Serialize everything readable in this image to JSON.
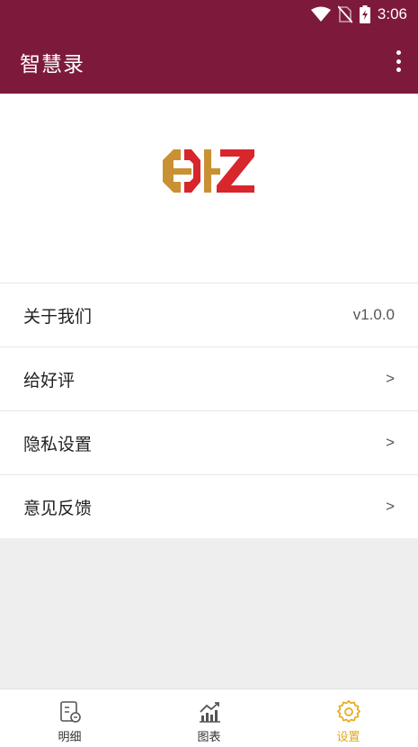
{
  "status_bar": {
    "time": "3:06",
    "icons": [
      "wifi-icon",
      "no-sim-icon",
      "battery-charging-icon"
    ]
  },
  "app_bar": {
    "title": "智慧录",
    "menu_icon": "more-vert-icon"
  },
  "logo": {
    "name": "hdz-logo",
    "text": "HDZ",
    "colors": {
      "gold": "#c99133",
      "red": "#d7262c"
    }
  },
  "settings": {
    "items": [
      {
        "label": "关于我们",
        "value": "v1.0.0"
      },
      {
        "label": "给好评",
        "value": ">"
      },
      {
        "label": "隐私设置",
        "value": ">"
      },
      {
        "label": "意见反馈",
        "value": ">"
      }
    ]
  },
  "bottom_nav": {
    "items": [
      {
        "label": "明细",
        "icon": "details-icon",
        "active": false
      },
      {
        "label": "图表",
        "icon": "chart-icon",
        "active": false
      },
      {
        "label": "设置",
        "icon": "gear-icon",
        "active": true
      }
    ]
  },
  "colors": {
    "primary": "#7d1a3c",
    "active_tab": "#e6a817",
    "background": "#eeeeee"
  }
}
